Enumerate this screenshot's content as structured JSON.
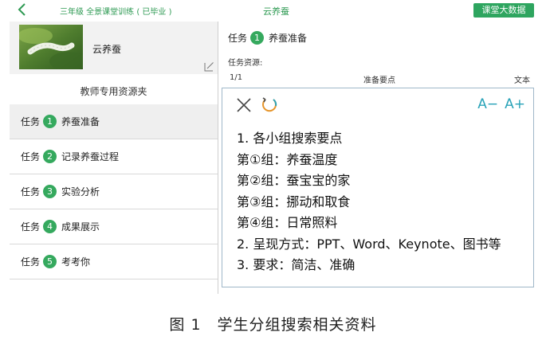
{
  "topbar": {
    "class_title": "三年级 全景课堂训练 ( 已毕业 )",
    "app_title": "云养蚕",
    "bigdata_button": "课堂大数据"
  },
  "course": {
    "name": "云养蚕"
  },
  "folder_label": "教师专用资源夹",
  "tasks": [
    {
      "prefix": "任务",
      "num": "1",
      "label": "养蚕准备"
    },
    {
      "prefix": "任务",
      "num": "2",
      "label": "记录养蚕过程"
    },
    {
      "prefix": "任务",
      "num": "3",
      "label": "实验分析"
    },
    {
      "prefix": "任务",
      "num": "4",
      "label": "成果展示"
    },
    {
      "prefix": "任务",
      "num": "5",
      "label": "考考你"
    }
  ],
  "detail": {
    "prefix": "任务",
    "num": "1",
    "title": "养蚕准备",
    "resource_label": "任务资源:",
    "resource": {
      "page": "1/1",
      "name": "准备要点",
      "type": "文本"
    },
    "font_minus": "A−",
    "font_plus": "A+",
    "lines": [
      "1. 各小组搜索要点",
      "第①组：养蚕温度",
      "第②组：蚕宝宝的家",
      "第③组：挪动和取食",
      "第④组：日常照料",
      "2. 呈现方式：PPT、Word、Keynote、图书等",
      "3. 要求：简洁、准确"
    ]
  },
  "caption": "图 1　学生分组搜索相关资料",
  "colors": {
    "accent": "#35a95e",
    "link": "#2aa3b8",
    "topbar_text": "#2e9a53"
  }
}
